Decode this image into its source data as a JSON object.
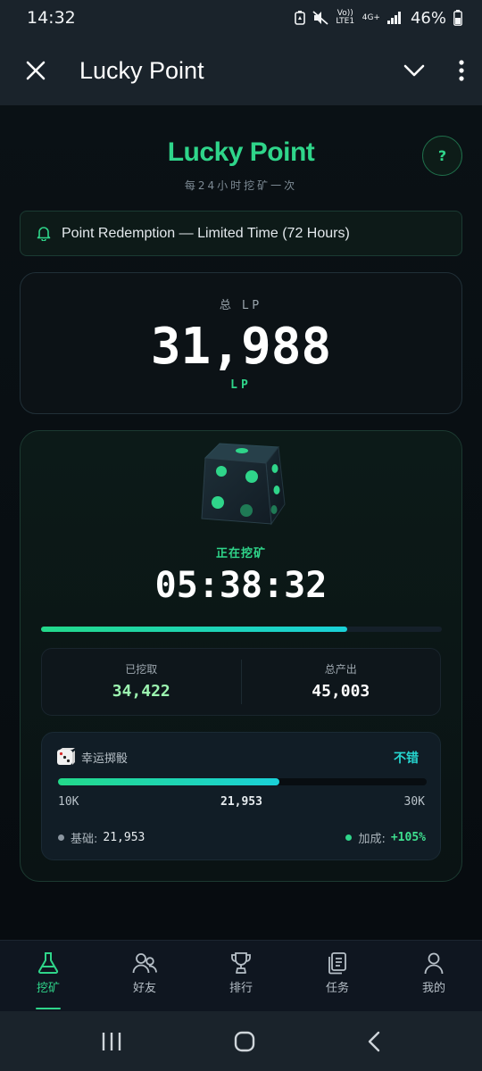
{
  "status_bar": {
    "time": "14:32",
    "volte": "Vo)) LTE1",
    "network": "4G+",
    "battery": "46%"
  },
  "app_bar": {
    "title": "Lucky Point"
  },
  "header": {
    "brand": "Lucky Point",
    "subtitle": "每24小时挖矿一次",
    "help_label": "?"
  },
  "notice": {
    "text": "Point Redemption — Limited Time (72 Hours)"
  },
  "total": {
    "label": "总 LP",
    "value": "31,988",
    "unit": "LP"
  },
  "mining": {
    "status": "正在挖矿",
    "timer": "05:38:32",
    "progress": 0.765,
    "mined_label": "已挖取",
    "mined_value": "34,422",
    "output_label": "总产出",
    "output_value": "45,003"
  },
  "lucky_dice": {
    "title": "幸运掷骰",
    "rating": "不错",
    "min": "10K",
    "current": "21,953",
    "max": "30K",
    "progress": 0.6,
    "base_label": "基础:",
    "base_value": "21,953",
    "bonus_label": "加成:",
    "bonus_value": "+105%"
  },
  "nav": {
    "items": [
      {
        "label": "挖矿",
        "icon": "flask-icon"
      },
      {
        "label": "好友",
        "icon": "friends-icon"
      },
      {
        "label": "排行",
        "icon": "trophy-icon"
      },
      {
        "label": "任务",
        "icon": "tasks-icon"
      },
      {
        "label": "我的",
        "icon": "profile-icon"
      }
    ],
    "active": 0
  },
  "colors": {
    "accent": "#2fd58a",
    "cyan": "#1ad1d8",
    "background": "#070b0f"
  }
}
